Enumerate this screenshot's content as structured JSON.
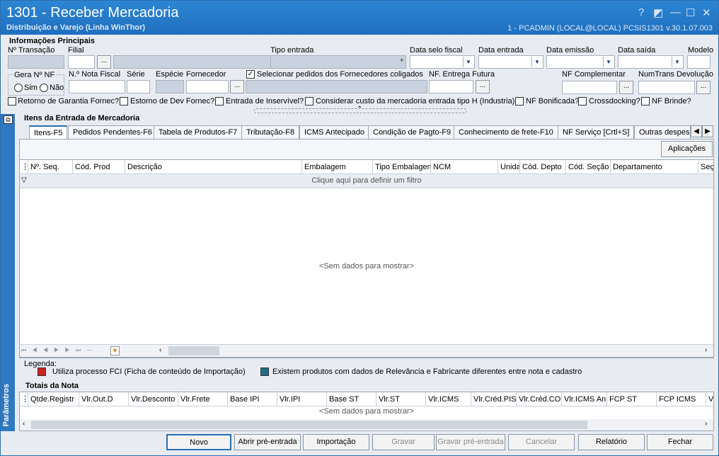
{
  "window": {
    "title": "1301 - Receber Mercadoria",
    "subtitle": "Distribuição e Varejo (Linha WinThor)",
    "info": "1 - PCADMIN (LOCAL@LOCAL)   PCSIS1301  v.30.1.07.003",
    "controls": [
      "?",
      "◩",
      "—",
      "☐",
      "✕"
    ]
  },
  "principal": {
    "heading": "Informações Principais",
    "labels": {
      "transacao": "Nº Transação",
      "filial": "Filial",
      "tipo_entrada": "Tipo entrada",
      "data_selo": "Data selo fiscal",
      "data_entrada": "Data entrada",
      "data_emissao": "Data emissão",
      "data_saida": "Data saída",
      "modelo": "Modelo",
      "gera_nf": "Gera Nº NF",
      "sim": "Sim",
      "nao": "Não",
      "nota_fiscal": "N.º Nota Fiscal",
      "serie": "Série",
      "especie": "Espécie",
      "fornecedor": "Fornecedor",
      "selecionar": "Selecionar pedidos dos Fornecedores coligados",
      "nf_entrega": "NF. Entrega Futura",
      "nf_complementar": "NF Complementar",
      "numtrans": "NumTrans Devolução"
    },
    "ellipsis": "...",
    "checks": {
      "retorno": "Retorno de Garantia Fornec?",
      "estorno": "Estorno de Dev Fornec?",
      "inservivel": "Entrada de Inservível?",
      "custo": "Considerar custo da mercadoria entrada tipo H (Industria)",
      "bonificada": "NF Bonificada?",
      "crossdocking": "Crossdocking?",
      "brinde": "NF Brinde?"
    },
    "selecionar_checked": "✓"
  },
  "itens": {
    "heading": "Itens da Entrada de Mercadoria",
    "tabs": [
      "Itens-F5",
      "Pedidos Pendentes-F6",
      "Tabela de Produtos-F7",
      "Tributação-F8",
      "ICMS Antecipado",
      "Condição de Pagto-F9",
      "Conhecimento de frete-F10",
      "NF Serviço [Crtl+S]",
      "Outras despes"
    ],
    "aplicacoes": "Aplicações",
    "columns": [
      "Nº. Seq.",
      "Cód. Prod",
      "Descrição",
      "Embalagem",
      "Tipo Embalagem",
      "NCM",
      "Unida",
      "Cód. Depto",
      "Cód. Seção",
      "Departamento",
      "Seç"
    ],
    "filter_hint": "Clique aqui para definir um filtro",
    "empty": "<Sem dados para mostrar>"
  },
  "legenda": {
    "label": "Legenda:",
    "items": [
      {
        "color": "#c8231c",
        "text": "Utiliza processo FCI (Ficha de conteúdo de Importação)"
      },
      {
        "color": "#1b6e84",
        "text": "Existem produtos com dados de Relevância e Fabricante diferentes entre nota e cadastro"
      }
    ]
  },
  "totais": {
    "heading": "Totais da Nota",
    "columns": [
      "Qtde.Registr",
      "Vlr.Out.D",
      "Vlr.Desconto",
      "Vlr.Frete",
      "Base IPI",
      "Vlr.IPI",
      "Base ST",
      "Vlr.ST",
      "Vlr.ICMS",
      "Vlr.Créd.PIS",
      "Vlr.Créd.CO",
      "Vlr.ICMS An",
      "FCP ST",
      "FCP ICMS",
      "Vl"
    ],
    "empty": "<Sem dados para mostrar>"
  },
  "sidebar": {
    "label": "Parâmetros"
  },
  "buttons": [
    "Novo",
    "Abrir pré-entrada",
    "Importação",
    "Gravar",
    "Gravar pré-entrada",
    "Cancelar",
    "Relatório",
    "Fechar"
  ],
  "colors": {
    "accent": "#2a6fb0",
    "titlebar": "#1f6fbf"
  }
}
